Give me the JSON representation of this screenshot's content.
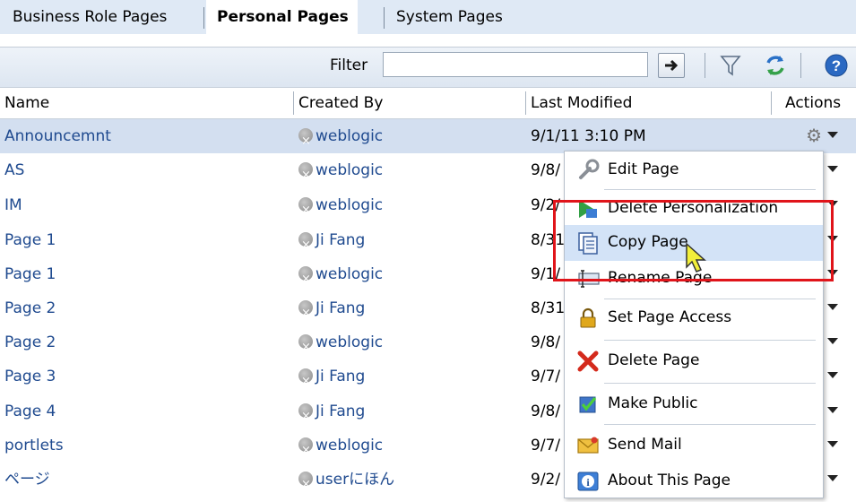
{
  "tabs": [
    {
      "label": "Business Role Pages"
    },
    {
      "label": "Personal Pages"
    },
    {
      "label": "System Pages"
    }
  ],
  "toolbar": {
    "filter_label": "Filter",
    "filter_value": "",
    "go_icon": "arrow-right-icon",
    "filter_icon": "funnel-icon",
    "refresh_icon": "refresh-icon",
    "help_icon": "help-icon"
  },
  "columns": {
    "name": "Name",
    "created_by": "Created By",
    "last_modified": "Last Modified",
    "actions": "Actions"
  },
  "rows": [
    {
      "name": "Announcemnt",
      "created_by": "weblogic",
      "modified": "9/1/11 3:10 PM"
    },
    {
      "name": "AS",
      "created_by": "weblogic",
      "modified": "9/8/"
    },
    {
      "name": "IM",
      "created_by": "weblogic",
      "modified": "9/2/"
    },
    {
      "name": "Page 1",
      "created_by": "Ji Fang",
      "modified": "8/31"
    },
    {
      "name": "Page 1",
      "created_by": "weblogic",
      "modified": "9/1/"
    },
    {
      "name": "Page 2",
      "created_by": "Ji Fang",
      "modified": "8/31"
    },
    {
      "name": "Page 2",
      "created_by": "weblogic",
      "modified": "9/8/"
    },
    {
      "name": "Page 3",
      "created_by": "Ji Fang",
      "modified": "9/7/"
    },
    {
      "name": "Page 4",
      "created_by": "Ji Fang",
      "modified": "9/8/"
    },
    {
      "name": "portlets",
      "created_by": "weblogic",
      "modified": "9/7/"
    },
    {
      "name": "ページ",
      "created_by": "userにほん",
      "modified": "9/2/"
    }
  ],
  "menu": {
    "items": [
      {
        "label": "Edit Page",
        "icon": "wrench-icon"
      },
      {
        "label": "Delete Personalization",
        "icon": "delete-personalization-icon"
      },
      {
        "label": "Copy Page",
        "icon": "copy-icon"
      },
      {
        "label": "Rename Page",
        "icon": "rename-icon"
      },
      {
        "label": "Set Page Access",
        "icon": "lock-icon"
      },
      {
        "label": "Delete Page",
        "icon": "red-x-icon"
      },
      {
        "label": "Make Public",
        "icon": "checkbox-icon"
      },
      {
        "label": "Send Mail",
        "icon": "mail-icon"
      },
      {
        "label": "About This Page",
        "icon": "info-icon"
      }
    ],
    "highlighted": "Copy Page"
  },
  "colors": {
    "link": "#1f4a8f",
    "selected_row": "#d3dff0",
    "highlight_box": "#e0141a"
  }
}
